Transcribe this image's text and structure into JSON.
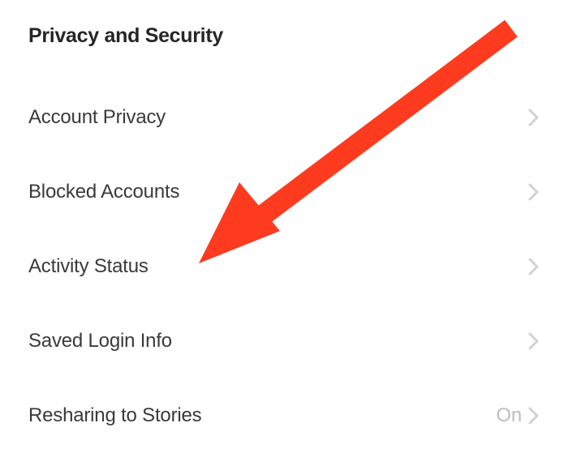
{
  "section": {
    "title": "Privacy and Security"
  },
  "menu": {
    "items": [
      {
        "label": "Account Privacy",
        "value": ""
      },
      {
        "label": "Blocked Accounts",
        "value": ""
      },
      {
        "label": "Activity Status",
        "value": ""
      },
      {
        "label": "Saved Login Info",
        "value": ""
      },
      {
        "label": "Resharing to Stories",
        "value": "On"
      }
    ]
  },
  "annotation": {
    "arrow_color": "#ff3b1f"
  }
}
